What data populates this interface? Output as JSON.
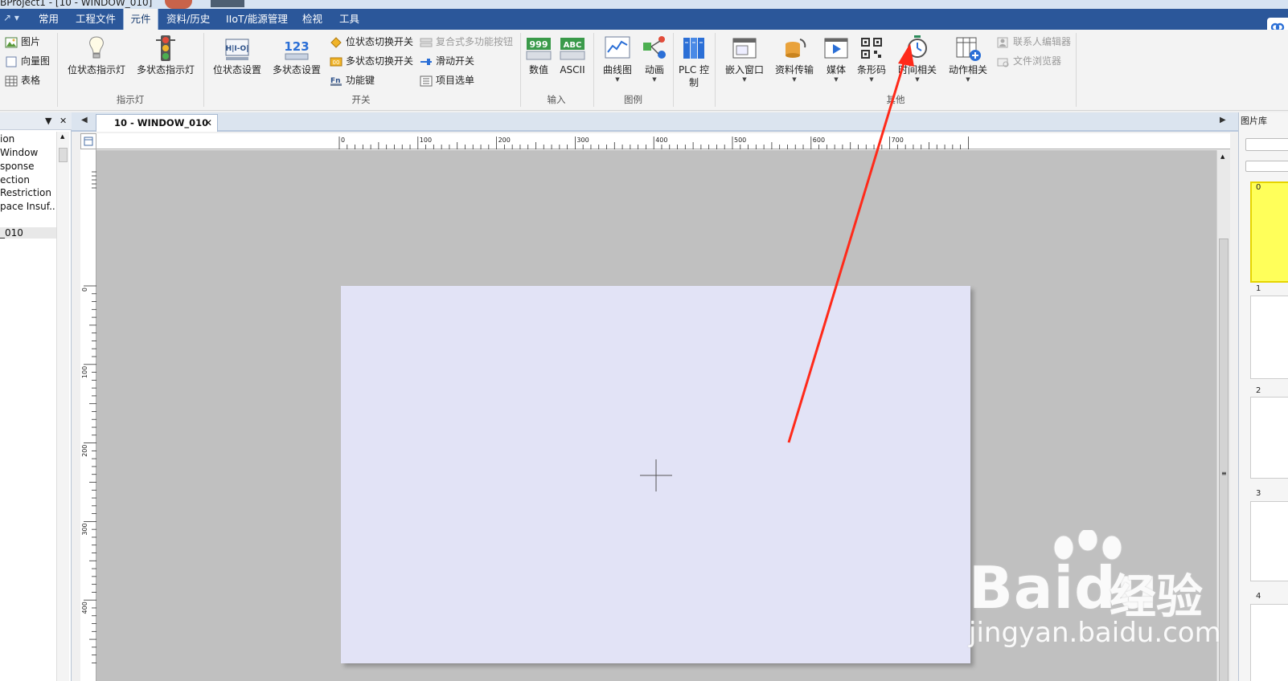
{
  "title_bar": {
    "text": "BProject1 - [10 - WINDOW_010]"
  },
  "menu": {
    "quick_access": "↗ ▾",
    "tabs": [
      "常用",
      "工程文件",
      "元件",
      "资料/历史",
      "IIoT/能源管理",
      "检视",
      "工具"
    ],
    "active_tab": "元件"
  },
  "ribbon": {
    "small_left": [
      {
        "label": "图片",
        "icon": "picture-icon"
      },
      {
        "label": "向量图",
        "icon": "vector-shape-icon"
      },
      {
        "label": "表格",
        "icon": "table-icon"
      }
    ],
    "indicator": {
      "group": "指示灯",
      "buttons": [
        {
          "label": "位状态指示灯",
          "icon": "lightbulb-icon"
        },
        {
          "label": "多状态指示灯",
          "icon": "traffic-light-icon"
        }
      ]
    },
    "switch": {
      "group": "开关",
      "buttons": [
        {
          "label": "位状态设置",
          "icon": "bit-set-icon"
        },
        {
          "label": "多状态设置",
          "icon": "multi-set-icon",
          "glyph": "123"
        }
      ],
      "small": [
        {
          "label": "位状态切换开关",
          "icon": "toggle-switch-icon"
        },
        {
          "label": "多状态切换开关",
          "icon": "multi-switch-icon"
        },
        {
          "label": "功能键",
          "icon": "function-key-icon"
        },
        {
          "label": "复合式多功能按钮",
          "icon": "combo-button-icon",
          "disabled": true
        },
        {
          "label": "滑动开关",
          "icon": "slide-switch-icon"
        },
        {
          "label": "项目选单",
          "icon": "item-list-icon"
        }
      ]
    },
    "input": {
      "group": "输入",
      "buttons": [
        {
          "label": "数值",
          "icon": "numeric-icon",
          "glyph": "999"
        },
        {
          "label": "ASCII",
          "icon": "ascii-icon",
          "glyph": "ABC"
        }
      ]
    },
    "legend": {
      "group": "图例",
      "buttons": [
        {
          "label": "曲线图",
          "icon": "trend-chart-icon"
        },
        {
          "label": "动画",
          "icon": "animation-icon"
        }
      ]
    },
    "plc": {
      "label": "PLC 控制",
      "icon": "plc-control-icon"
    },
    "other": {
      "group": "其他",
      "buttons": [
        {
          "label": "嵌入窗口",
          "icon": "embed-window-icon"
        },
        {
          "label": "资料传输",
          "icon": "data-transfer-icon"
        },
        {
          "label": "媒体",
          "icon": "media-icon"
        },
        {
          "label": "条形码",
          "icon": "qrcode-icon"
        },
        {
          "label": "时间相关",
          "icon": "timer-icon"
        },
        {
          "label": "动作相关",
          "icon": "action-icon"
        }
      ],
      "small": [
        {
          "label": "联系人编辑器",
          "icon": "contact-editor-icon",
          "disabled": true
        },
        {
          "label": "文件浏览器",
          "icon": "file-browser-icon",
          "disabled": true
        }
      ]
    }
  },
  "left_panel": {
    "items": [
      "ion",
      "Window",
      "sponse",
      "ection",
      "Restriction",
      "pace Insuf...",
      "",
      "_010"
    ],
    "selected_index": 7
  },
  "document": {
    "tab_label": "10 - WINDOW_010",
    "ruler_top_labels": [
      "0",
      "100",
      "200",
      "300",
      "400",
      "500",
      "600",
      "700"
    ],
    "ruler_left_labels": [
      "0",
      "100",
      "200",
      "300",
      "400"
    ]
  },
  "right_panel": {
    "title": "图片库",
    "slot_numbers": [
      "0",
      "1",
      "2",
      "3",
      "4"
    ]
  },
  "watermark": {
    "brand": "Baidu",
    "cn": "经验",
    "url": "jingyan.baidu.com"
  },
  "colors": {
    "menu_blue": "#2b579a",
    "canvas": "#e2e3f6",
    "workspace": "#c0c0c0",
    "arrow": "#ff2a1a",
    "highlight": "#ffff5a"
  }
}
